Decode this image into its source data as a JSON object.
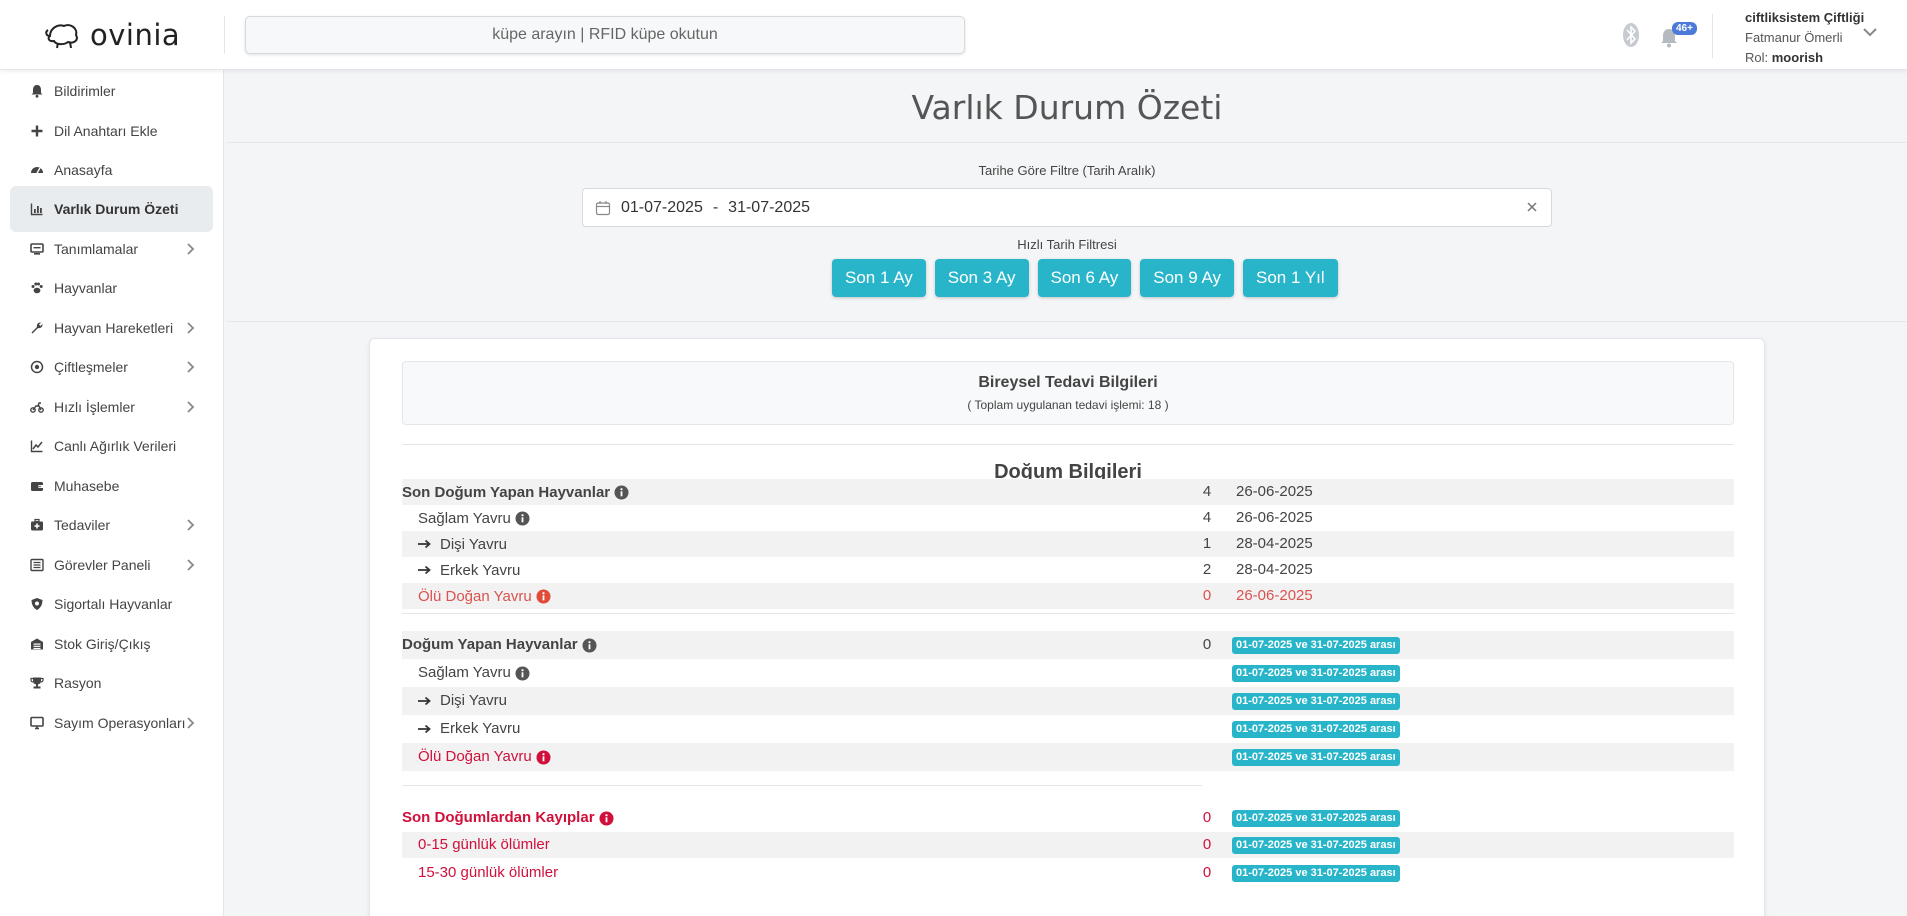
{
  "header": {
    "logo_text": "ovinia",
    "search_placeholder": "küpe arayın | RFID küpe okutun",
    "notification_badge": "46+",
    "farm_name": "ciftliksistem Çiftliği",
    "user_name": "Fatmanur Ömerli",
    "role_label": "Rol:",
    "role_value": "moorish"
  },
  "sidebar": {
    "items": [
      {
        "label": "Bildirimler",
        "icon": "bell-icon"
      },
      {
        "label": "Dil Anahtarı Ekle",
        "icon": "plus-icon"
      },
      {
        "label": "Anasayfa",
        "icon": "dashboard-icon"
      },
      {
        "label": "Varlık Durum Özeti",
        "icon": "chart-icon",
        "active": true
      },
      {
        "label": "Tanımlamalar",
        "icon": "monitor-icon",
        "expandable": true
      },
      {
        "label": "Hayvanlar",
        "icon": "paw-icon"
      },
      {
        "label": "Hayvan Hareketleri",
        "icon": "wrench-icon",
        "expandable": true
      },
      {
        "label": "Çiftleşmeler",
        "icon": "target-icon",
        "expandable": true
      },
      {
        "label": "Hızlı İşlemler",
        "icon": "motorcycle-icon",
        "expandable": true
      },
      {
        "label": "Canlı Ağırlık Verileri",
        "icon": "line-chart-icon"
      },
      {
        "label": "Muhasebe",
        "icon": "wallet-icon"
      },
      {
        "label": "Tedaviler",
        "icon": "medkit-icon",
        "expandable": true
      },
      {
        "label": "Görevler Paneli",
        "icon": "list-icon",
        "expandable": true
      },
      {
        "label": "Sigortalı Hayvanlar",
        "icon": "shield-icon"
      },
      {
        "label": "Stok Giriş/Çıkış",
        "icon": "warehouse-icon"
      },
      {
        "label": "Rasyon",
        "icon": "trophy-icon"
      },
      {
        "label": "Sayım Operasyonları",
        "icon": "desktop-icon",
        "expandable": true
      }
    ]
  },
  "main": {
    "title": "Varlık Durum Özeti",
    "filter_label": "Tarihe Göre Filtre (Tarih Aralık)",
    "date_start": "01-07-2025",
    "date_sep": "-",
    "date_end": "31-07-2025",
    "quick_label": "Hızlı Tarih Filtresi",
    "quick_buttons": [
      "Son 1 Ay",
      "Son 3 Ay",
      "Son 6 Ay",
      "Son 9 Ay",
      "Son 1 Yıl"
    ],
    "treatment": {
      "title": "Bireysel Tedavi Bilgileri",
      "subtitle": "( Toplam uygulanan tedavi işlemi: 18 )"
    },
    "birth_title": "Doğum Bilgileri",
    "recent_births": [
      {
        "label": "Son Doğum Yapan Hayvanlar",
        "value": "4",
        "date": "26-06-2025"
      },
      {
        "label": "Sağlam Yavru",
        "value": "4",
        "date": "26-06-2025"
      },
      {
        "label": "Dişi Yavru",
        "value": "1",
        "date": "28-04-2025"
      },
      {
        "label": "Erkek Yavru",
        "value": "2",
        "date": "28-04-2025"
      },
      {
        "label": "Ölü Doğan Yavru",
        "value": "0",
        "date": "26-06-2025"
      }
    ],
    "range_births": [
      {
        "label": "Doğum Yapan Hayvanlar",
        "value": "0",
        "range": "01-07-2025 ve 31-07-2025 arası"
      },
      {
        "label": "Sağlam Yavru",
        "value": "",
        "range": "01-07-2025 ve 31-07-2025 arası"
      },
      {
        "label": "Dişi Yavru",
        "value": "",
        "range": "01-07-2025 ve 31-07-2025 arası"
      },
      {
        "label": "Erkek Yavru",
        "value": "",
        "range": "01-07-2025 ve 31-07-2025 arası"
      },
      {
        "label": "Ölü Doğan Yavru",
        "value": "",
        "range": "01-07-2025 ve 31-07-2025 arası"
      }
    ],
    "losses": [
      {
        "label": "Son Doğumlardan Kayıplar",
        "value": "0",
        "range": "01-07-2025 ve 31-07-2025 arası"
      },
      {
        "label": "0-15 günlük ölümler",
        "value": "0",
        "range": "01-07-2025 ve 31-07-2025 arası"
      },
      {
        "label": "15-30 günlük ölümler",
        "value": "0",
        "range": "01-07-2025 ve 31-07-2025 arası"
      }
    ]
  },
  "colors": {
    "accent": "#29b5c9",
    "danger": "#d9534f",
    "loss": "#d0103a",
    "badge": "#4c7ad8"
  }
}
